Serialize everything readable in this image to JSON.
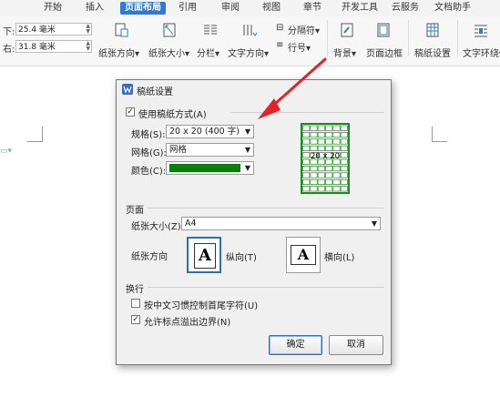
{
  "ribbon": {
    "tabs": [
      {
        "label": "开始",
        "active": false
      },
      {
        "label": "插入",
        "active": false
      },
      {
        "label": "页面布局",
        "active": true
      },
      {
        "label": "引用",
        "active": false
      },
      {
        "label": "审阅",
        "active": false
      },
      {
        "label": "视图",
        "active": false
      },
      {
        "label": "章节",
        "active": false
      },
      {
        "label": "开发工具",
        "active": false
      },
      {
        "label": "云服务",
        "active": false
      },
      {
        "label": "文档助手",
        "active": false
      }
    ],
    "margins": {
      "bottom_label": "下:",
      "bottom_value": "25.4 毫米",
      "right_label": "右:",
      "right_value": "31.8 毫米"
    },
    "buttons": {
      "orientation": "纸张方向",
      "size": "纸张大小",
      "columns": "分栏",
      "text_direction": "文字方向",
      "separator": "分隔符",
      "line_number": "行号",
      "background": "背景",
      "page_border": "页面边框",
      "manuscript": "稿纸设置",
      "wrap": "文字环绕"
    }
  },
  "dialog": {
    "title": "稿纸设置",
    "use_manuscript": {
      "label": "使用稿纸方式(A)",
      "checked": true
    },
    "spec_label": "规格(S):",
    "spec_value": "20 x 20 (400 字)",
    "grid_label": "网格(G):",
    "grid_value": "网格",
    "color_label": "颜色(C):",
    "color_value": "#0a7d0a",
    "preview_label": "20 x 20",
    "preview_color": "#1f8a1f",
    "page_section": "页面",
    "paper_size_label": "纸张大小(Z):",
    "paper_size_value": "A4",
    "orientation_label": "纸张方向",
    "portrait_label": "纵向(T)",
    "landscape_label": "横向(L)",
    "orientation_glyph": "A",
    "wrap_section": "换行",
    "chk_cjk": {
      "label": "按中文习惯控制首尾字符(U)",
      "checked": false
    },
    "chk_punct": {
      "label": "允许标点溢出边界(N)",
      "checked": true
    },
    "ok_label": "确定",
    "cancel_label": "取消"
  },
  "annotation": {
    "arrow_color": "#e8202a"
  }
}
